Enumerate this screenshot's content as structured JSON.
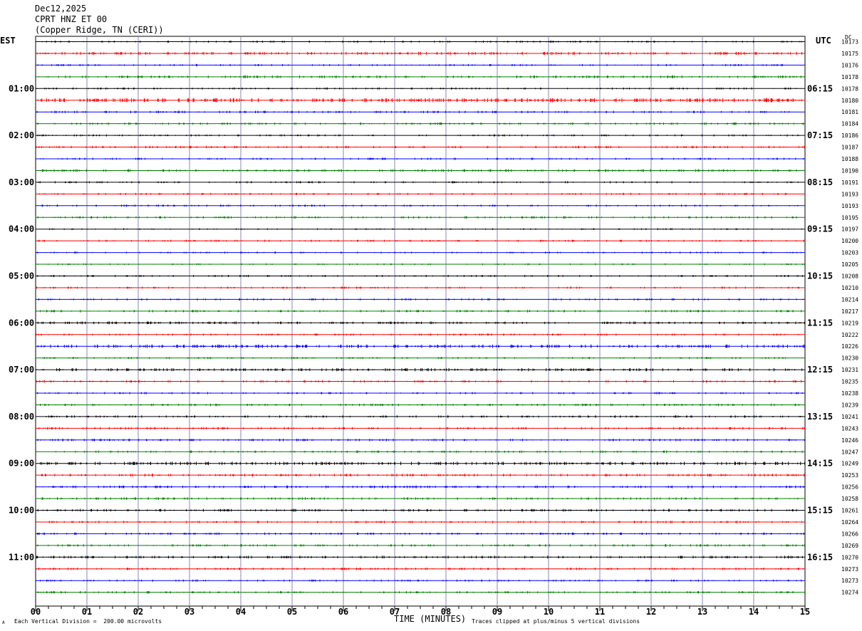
{
  "header": {
    "date": "Dec12,2025",
    "channel": "CPRT HNZ ET 00",
    "location": "(Copper Ridge, TN (CERI))"
  },
  "left_tz": "EST",
  "right_tz": "UTC",
  "dc_label": "DC",
  "footer": {
    "xlabel": "TIME (MINUTES)",
    "scale_note": "Each Vertical Division =  200.00 microvolts",
    "clip_note": "Traces clipped at plus/minus 5 vertical divisions",
    "corner_mark": "A"
  },
  "chart_data": {
    "type": "line",
    "title": "CPRT HNZ ET 00",
    "xlabel": "TIME (MINUTES)",
    "xlim": [
      0,
      15
    ],
    "x_ticks": [
      "00",
      "01",
      "02",
      "03",
      "04",
      "05",
      "06",
      "07",
      "08",
      "09",
      "10",
      "11",
      "12",
      "13",
      "14",
      "15"
    ],
    "trace_colors": [
      "#000000",
      "#ff0000",
      "#0000ff",
      "#008000"
    ],
    "hour_labels_est": [
      "01:00",
      "02:00",
      "03:00",
      "04:00",
      "05:00",
      "06:00",
      "07:00",
      "08:00",
      "09:00",
      "10:00",
      "11:00"
    ],
    "hour_labels_utc": [
      "06:15",
      "07:15",
      "08:15",
      "09:15",
      "10:15",
      "11:15",
      "12:15",
      "13:15",
      "14:15",
      "15:15",
      "16:15"
    ],
    "dc_offsets": [
      10173,
      10175,
      10176,
      10178,
      10178,
      10180,
      10181,
      10184,
      10186,
      10187,
      10188,
      10190,
      10191,
      10193,
      10193,
      10195,
      10197,
      10200,
      10203,
      10205,
      10208,
      10210,
      10214,
      10217,
      10219,
      10222,
      10226,
      10230,
      10231,
      10235,
      10238,
      10239,
      10241,
      10243,
      10246,
      10247,
      10249,
      10253,
      10256,
      10258,
      10261,
      10264,
      10266,
      10269,
      10270,
      10273,
      10273,
      10274
    ],
    "trace_activity": [
      0.2,
      0.5,
      0.2,
      0.4,
      0.2,
      0.8,
      0.3,
      0.3,
      0.2,
      0.3,
      0.2,
      0.4,
      0.2,
      0.2,
      0.2,
      0.3,
      0.1,
      0.2,
      0.1,
      0.1,
      0.2,
      0.2,
      0.2,
      0.3,
      0.4,
      0.2,
      0.6,
      0.2,
      0.5,
      0.3,
      0.2,
      0.3,
      0.3,
      0.3,
      0.3,
      0.3,
      0.6,
      0.4,
      0.4,
      0.3,
      0.4,
      0.3,
      0.3,
      0.3,
      0.4,
      0.3,
      0.2,
      0.3
    ]
  }
}
